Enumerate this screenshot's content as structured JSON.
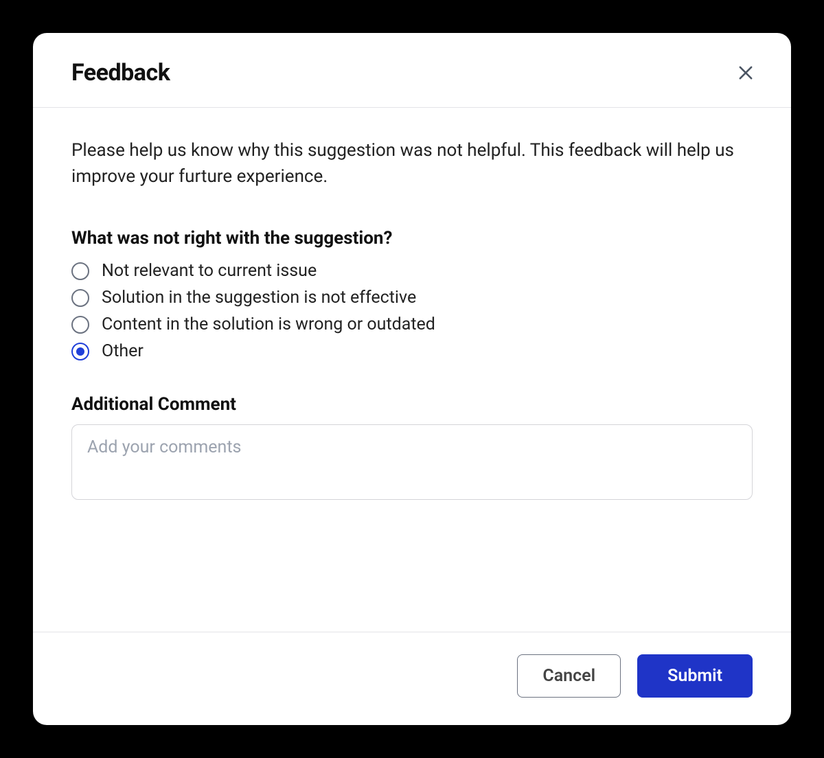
{
  "modal": {
    "title": "Feedback",
    "intro": "Please help us know why this suggestion was not helpful. This feedback will help us improve your furture experience.",
    "question": "What was not right with the suggestion?",
    "options": [
      {
        "label": "Not relevant to current issue",
        "selected": false
      },
      {
        "label": "Solution in the suggestion is not effective",
        "selected": false
      },
      {
        "label": "Content in the solution is wrong or outdated",
        "selected": false
      },
      {
        "label": "Other",
        "selected": true
      }
    ],
    "comment_label": "Additional Comment",
    "comment_placeholder": "Add your comments",
    "comment_value": "",
    "cancel_label": "Cancel",
    "submit_label": "Submit"
  }
}
